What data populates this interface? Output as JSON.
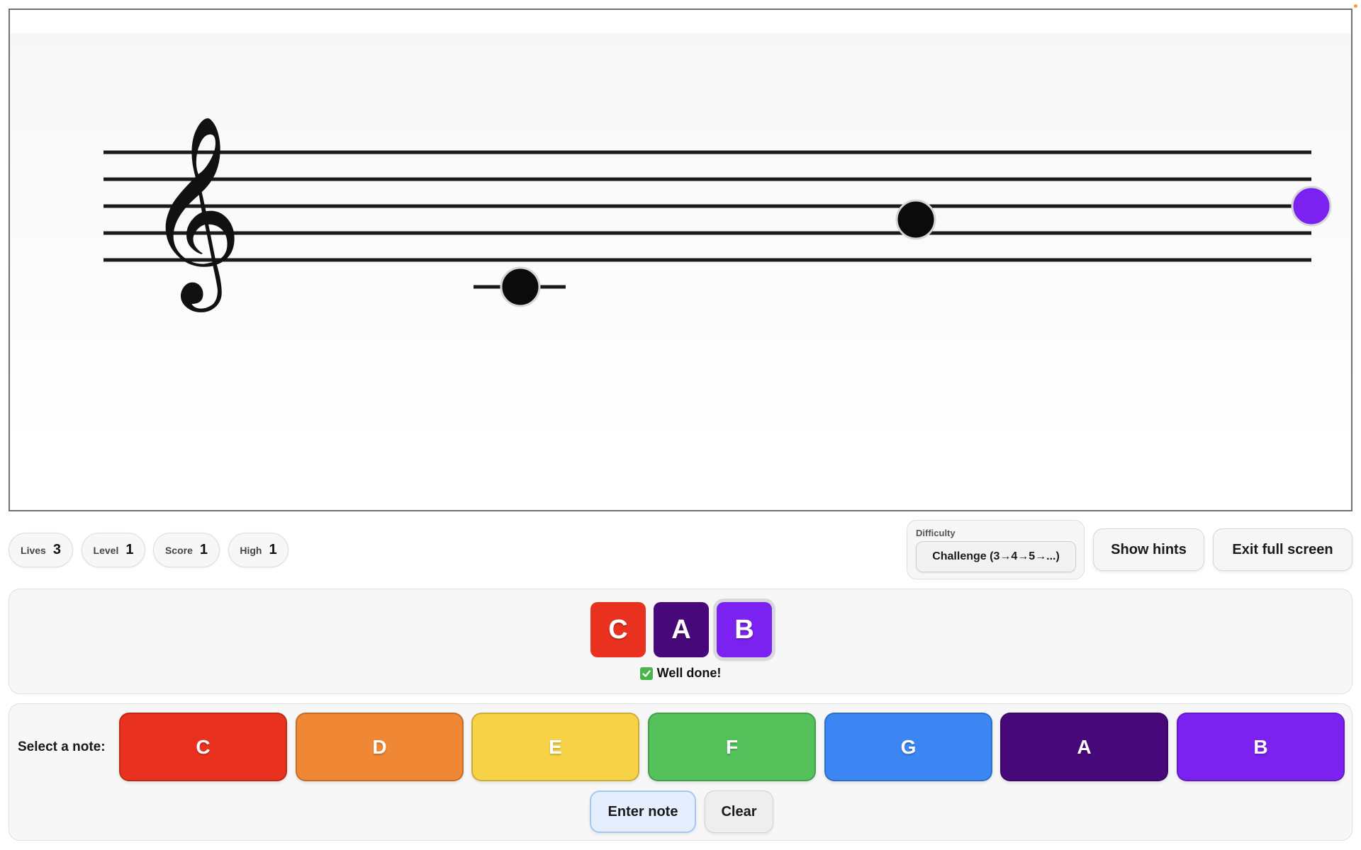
{
  "staff": {
    "clef": "𝄞",
    "notes": [
      {
        "name": "C",
        "color": "#111111",
        "state": "answered"
      },
      {
        "name": "A",
        "color": "#111111",
        "state": "answered"
      },
      {
        "name": "B",
        "color": "#7b22f0",
        "state": "current"
      }
    ]
  },
  "stats": [
    {
      "label": "Lives",
      "value": "3"
    },
    {
      "label": "Level",
      "value": "1"
    },
    {
      "label": "Score",
      "value": "1"
    },
    {
      "label": "High",
      "value": "1"
    }
  ],
  "difficulty": {
    "label": "Difficulty",
    "selected": "Challenge (3→4→5→...)"
  },
  "buttons": {
    "show_hints": "Show hints",
    "exit_fullscreen": "Exit full screen",
    "enter_note": "Enter note",
    "clear": "Clear"
  },
  "answer": {
    "chips": [
      {
        "label": "C",
        "color": "#e8321f"
      },
      {
        "label": "A",
        "color": "#47097a"
      },
      {
        "label": "B",
        "color": "#7b22f0"
      }
    ],
    "feedback": "Well done!",
    "feedback_icon": "check-icon"
  },
  "note_select": {
    "label": "Select a note:",
    "notes": [
      {
        "label": "C",
        "color": "#e8321f"
      },
      {
        "label": "D",
        "color": "#ef8734"
      },
      {
        "label": "E",
        "color": "#f8d246"
      },
      {
        "label": "F",
        "color": "#55c15b"
      },
      {
        "label": "G",
        "color": "#3b86f3"
      },
      {
        "label": "A",
        "color": "#47097a"
      },
      {
        "label": "B",
        "color": "#7b22f0"
      }
    ]
  }
}
